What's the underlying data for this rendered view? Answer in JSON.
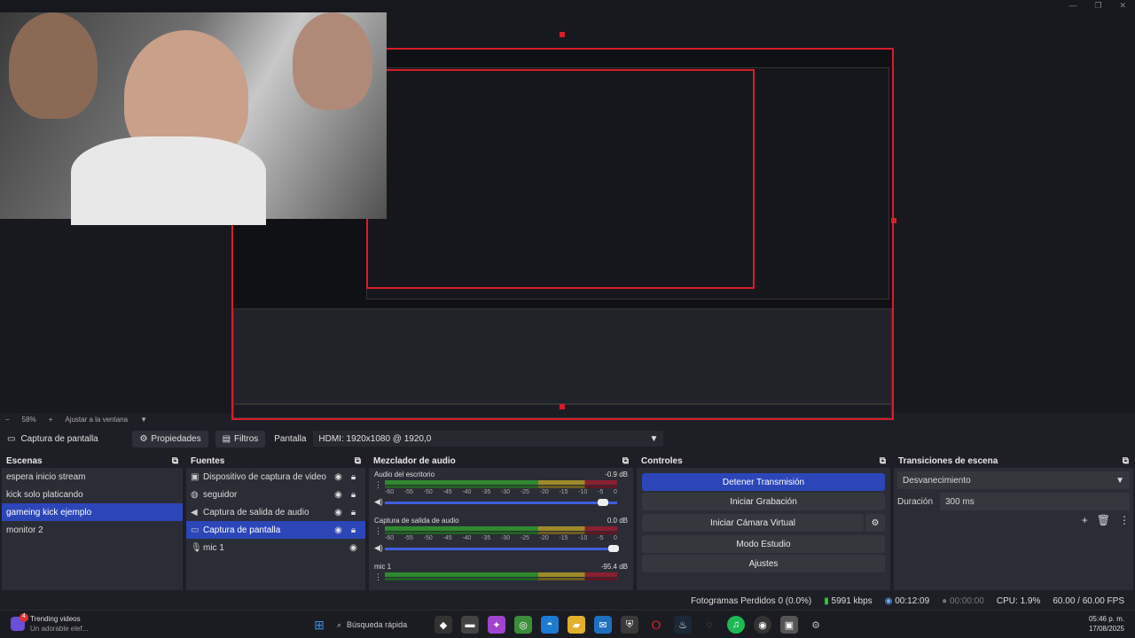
{
  "window": {
    "minimize": "—",
    "restore": "❐",
    "close": "✕"
  },
  "preview": {
    "zoom": "58%",
    "fit_label": "Ajustar a la ventana"
  },
  "source_bar": {
    "source_name": "Captura de pantalla",
    "properties": "Propiedades",
    "filters": "Filtros",
    "display_label": "Pantalla",
    "display_value": "HDMI: 1920x1080 @ 1920,0"
  },
  "scenes": {
    "title": "Escenas",
    "items": [
      {
        "label": "espera inicio stream",
        "selected": false
      },
      {
        "label": "kick solo platicando",
        "selected": false
      },
      {
        "label": "gameing kick ejemplo",
        "selected": true
      },
      {
        "label": "monitor 2",
        "selected": false
      }
    ]
  },
  "sources": {
    "title": "Fuentes",
    "items": [
      {
        "label": "Dispositivo de captura de video",
        "icon": "camera-icon"
      },
      {
        "label": "seguidor",
        "icon": "globe-icon"
      },
      {
        "label": "Captura de salida de audio",
        "icon": "speaker-icon"
      },
      {
        "label": "Captura de pantalla",
        "icon": "monitor-icon",
        "selected": true
      },
      {
        "label": "mic 1",
        "icon": "mic-icon"
      }
    ]
  },
  "mixer": {
    "title": "Mezclador de audio",
    "channels": [
      {
        "name": "Audio del escritorio",
        "db": "-0.9 dB"
      },
      {
        "name": "Captura de salida de audio",
        "db": "0.0 dB"
      },
      {
        "name": "mic 1",
        "db": "-95.4 dB"
      }
    ],
    "ticks": [
      "-60",
      "-55",
      "-50",
      "-45",
      "-40",
      "-35",
      "-30",
      "-25",
      "-20",
      "-15",
      "-10",
      "-5",
      "0"
    ]
  },
  "controls": {
    "title": "Controles",
    "stop_stream": "Detener Transmisión",
    "start_rec": "Iniciar Grabación",
    "virtual_cam": "Iniciar Cámara Virtual",
    "studio": "Modo Estudio",
    "settings": "Ajustes"
  },
  "transitions": {
    "title": "Transiciones de escena",
    "value": "Desvanecimiento",
    "duration_label": "Duración",
    "duration": "300 ms"
  },
  "status": {
    "dropped": "Fotogramas Perdidos 0 (0.0%)",
    "bitrate": "5991 kbps",
    "live_time": "00:12:09",
    "rec_time": "00:00:00",
    "cpu": "CPU: 1.9%",
    "fps": "60.00 / 60.00 FPS"
  },
  "taskbar": {
    "news_title": "Trending videos",
    "news_sub": "Un adorable elef...",
    "badge": "4",
    "search": "Búsqueda rápida",
    "time": "05:46 p. m.",
    "date": "17/08/2025"
  }
}
